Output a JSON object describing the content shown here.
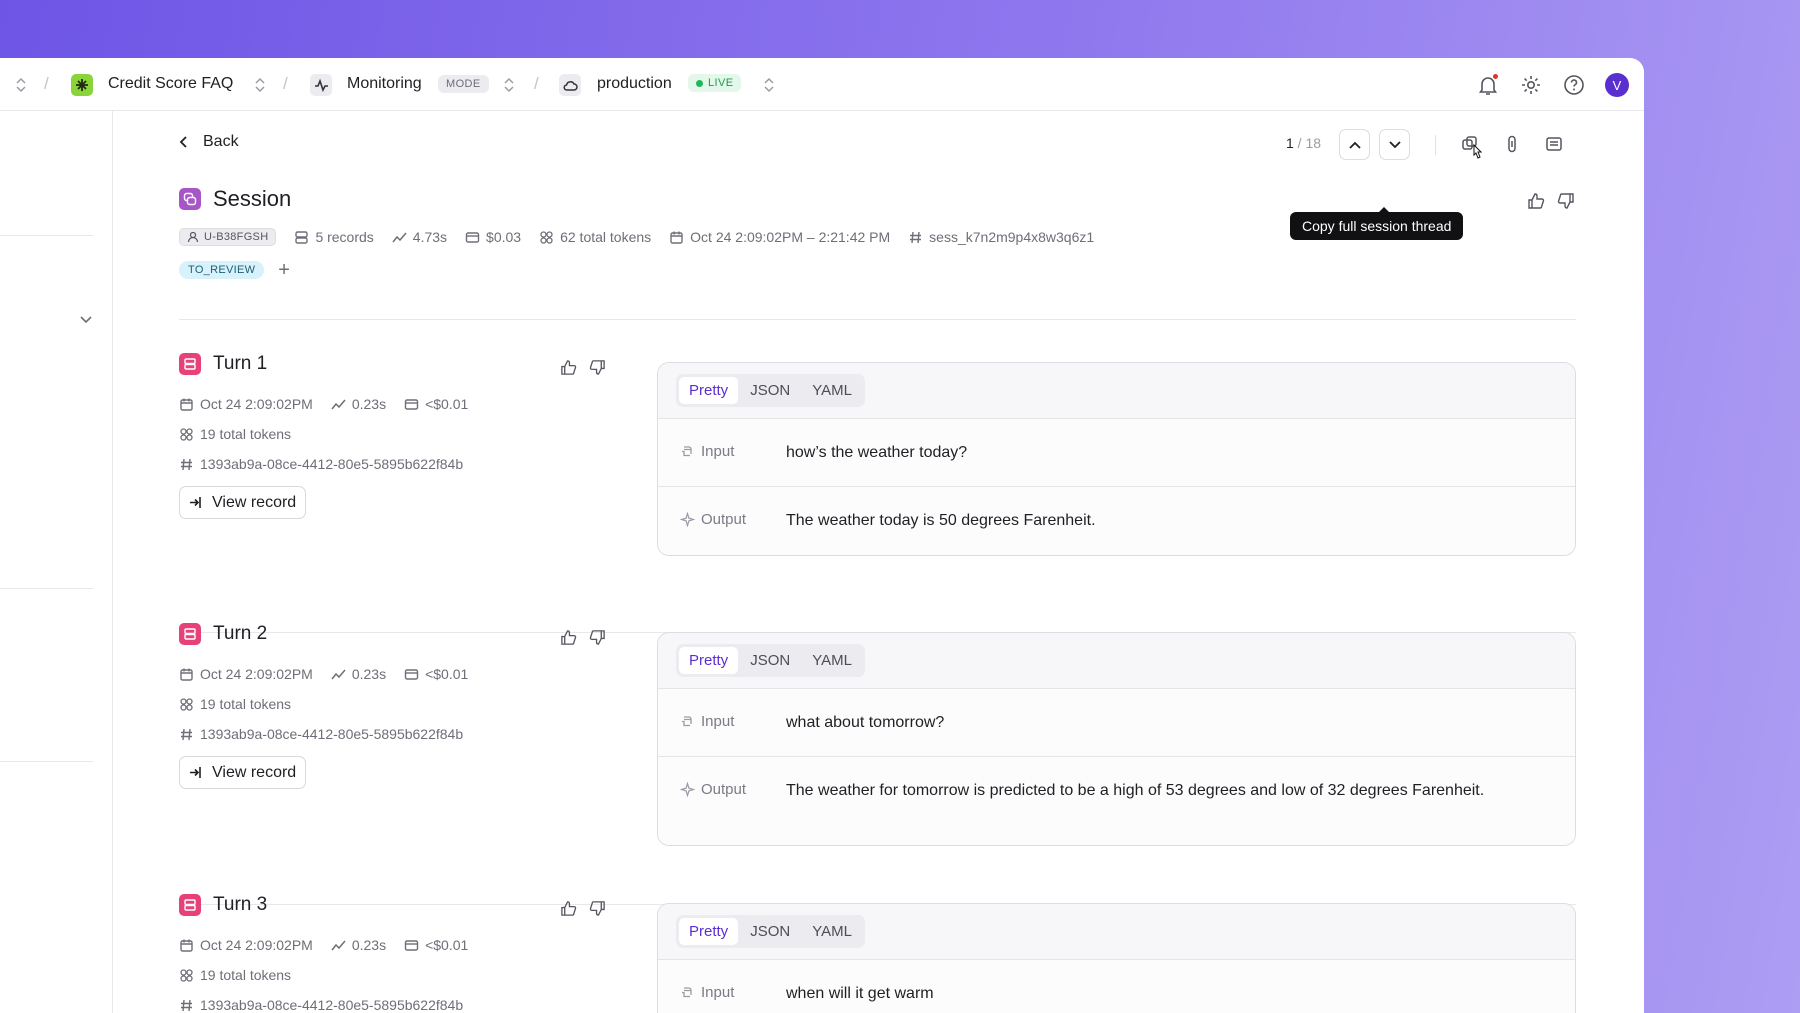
{
  "topbar": {
    "project": "Credit Score FAQ",
    "mode_label": "Monitoring",
    "mode_badge": "MODE",
    "env": "production",
    "env_badge": "LIVE",
    "avatar_initial": "V"
  },
  "nav": {
    "back": "Back",
    "page_current": "1",
    "page_total": " / 18",
    "tooltip": "Copy full session thread"
  },
  "session": {
    "title": "Session",
    "user_id": "U-B38FGSH",
    "records": "5 records",
    "latency": "4.73s",
    "cost": "$0.03",
    "tokens": "62 total tokens",
    "time_range": "Oct 24 2:09:02PM – 2:21:42 PM",
    "session_id": "sess_k7n2m9p4x8w3q6z1",
    "tag": "TO_REVIEW"
  },
  "format_tabs": [
    "Pretty",
    "JSON",
    "YAML"
  ],
  "labels": {
    "input": "Input",
    "output": "Output",
    "view_record": "View record"
  },
  "turns": [
    {
      "title": "Turn 1",
      "time": "Oct 24 2:09:02PM",
      "latency": "0.23s",
      "cost": "<$0.01",
      "tokens": "19 total tokens",
      "record_id": "1393ab9a-08ce-4412-80e5-5895b622f84b",
      "input": "how’s the weather today?",
      "output": "The weather today is 50 degrees Farenheit."
    },
    {
      "title": "Turn 2",
      "time": "Oct 24 2:09:02PM",
      "latency": "0.23s",
      "cost": "<$0.01",
      "tokens": "19 total tokens",
      "record_id": "1393ab9a-08ce-4412-80e5-5895b622f84b",
      "input": "what about tomorrow?",
      "output": "The weather for tomorrow is predicted to be a high of 53 degrees and low of 32 degrees Farenheit."
    },
    {
      "title": "Turn 3",
      "time": "Oct 24 2:09:02PM",
      "latency": "0.23s",
      "cost": "<$0.01",
      "tokens": "19 total tokens",
      "record_id": "1393ab9a-08ce-4412-80e5-5895b622f84b",
      "input": "when will it get warm"
    }
  ],
  "colors": {
    "accent": "#5b2fd3",
    "live": "#22b55b",
    "turn_icon": "#e7417a",
    "session_icon": "#a855c8",
    "project_icon": "#8ad43a",
    "notification": "#e0322d"
  }
}
